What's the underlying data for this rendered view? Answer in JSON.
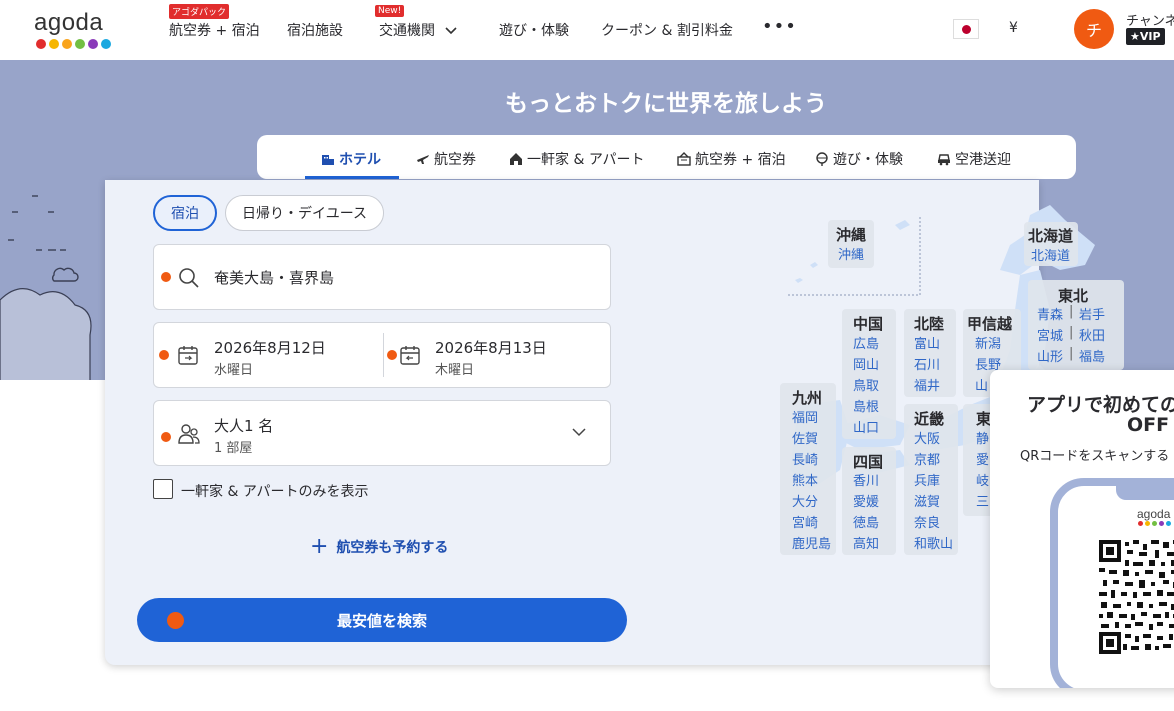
{
  "header": {
    "logo_text": "agoda",
    "logo_colors": [
      "#e12d2d",
      "#f6b600",
      "#f9a41c",
      "#73bf43",
      "#8a3ab9",
      "#1aa8e0"
    ],
    "nav": [
      {
        "label": "航空券 + 宿泊",
        "badge": "アゴダパック"
      },
      {
        "label": "宿泊施設"
      },
      {
        "label": "交通機関",
        "badge": "New!"
      },
      {
        "label": "遊び・体験"
      },
      {
        "label": "クーポン & 割引料金"
      }
    ],
    "more_label": "•••",
    "currency": "¥",
    "avatar_initial": "チ",
    "user_name": "チャンネ",
    "vip_label": "★VIP"
  },
  "hero": {
    "title": "もっとおトクに世界を旅しよう",
    "bg_color": "#98a4c9"
  },
  "tabs": [
    {
      "label": "ホテル",
      "icon": "hotel-icon"
    },
    {
      "label": "航空券",
      "icon": "plane-icon"
    },
    {
      "label": "一軒家 & アパート",
      "icon": "house-icon"
    },
    {
      "label": "航空券 + 宿泊",
      "icon": "package-icon"
    },
    {
      "label": "遊び・体験",
      "icon": "activities-icon"
    },
    {
      "label": "空港送迎",
      "icon": "car-icon"
    }
  ],
  "search": {
    "stay_types": [
      "宿泊",
      "日帰り・デイユース"
    ],
    "destination": "奄美大島・喜界島",
    "checkin_date": "2026年8月12日",
    "checkin_day": "水曜日",
    "checkout_date": "2026年8月13日",
    "checkout_day": "木曜日",
    "guests": "大人1 名",
    "rooms": "1 部屋",
    "home_only_label": "一軒家 & アパートのみを表示",
    "add_flight_label": "航空券も予約する",
    "submit_label": "最安値を検索",
    "accent_color": "#1f63d6",
    "dot_color": "#f05a12"
  },
  "map": {
    "okinawa": {
      "name": "沖縄",
      "prefs": [
        "沖縄"
      ]
    },
    "hokkaido": {
      "name": "北海道",
      "prefs": [
        "北海道"
      ]
    },
    "tohoku": {
      "name": "東北",
      "prefs": [
        "青森",
        "岩手",
        "宮城",
        "秋田",
        "山形",
        "福島"
      ]
    },
    "chugoku": {
      "name": "中国",
      "prefs": [
        "広島",
        "岡山",
        "鳥取",
        "島根",
        "山口"
      ]
    },
    "hokuriku": {
      "name": "北陸",
      "prefs": [
        "富山",
        "石川",
        "福井"
      ]
    },
    "koshinetsu": {
      "name": "甲信越",
      "prefs": [
        "新潟",
        "長野",
        "山"
      ]
    },
    "kyushu": {
      "name": "九州",
      "prefs": [
        "福岡",
        "佐賀",
        "長崎",
        "熊本",
        "大分",
        "宮崎",
        "鹿児島"
      ]
    },
    "shikoku": {
      "name": "四国",
      "prefs": [
        "香川",
        "愛媛",
        "徳島",
        "高知"
      ]
    },
    "kinki": {
      "name": "近畿",
      "prefs": [
        "大阪",
        "京都",
        "兵庫",
        "滋賀",
        "奈良",
        "和歌山"
      ]
    },
    "tokai": {
      "name": "東",
      "prefs": [
        "静",
        "愛",
        "岐",
        "三"
      ]
    }
  },
  "promo": {
    "title_line1": "アプリで初めての",
    "title_line2": "OFF",
    "subtitle": "QRコードをスキャンする",
    "logo_text": "agoda"
  }
}
